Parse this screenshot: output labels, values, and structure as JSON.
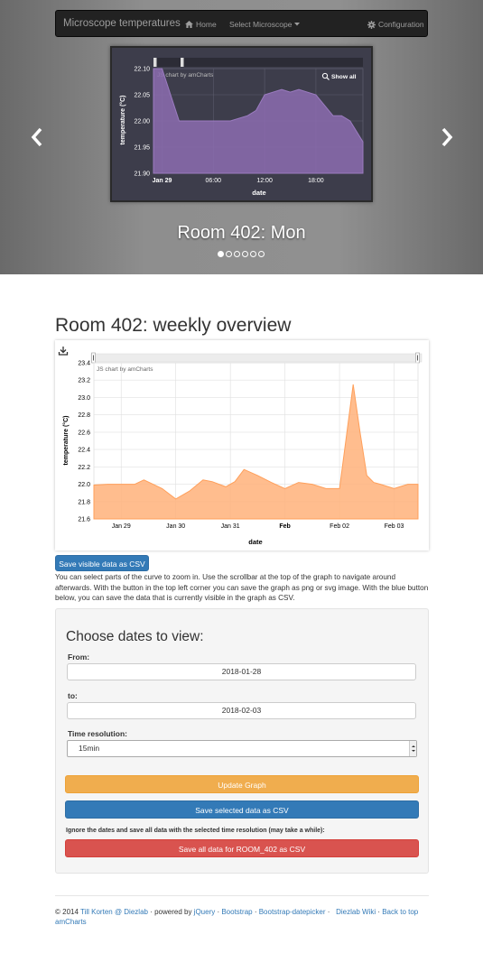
{
  "navbar": {
    "brand": "Microscope temperatures",
    "home": "Home",
    "select_microscope": "Select Microscope",
    "configuration": "Configuration"
  },
  "carousel": {
    "caption": "Room 402: Mon",
    "slide_count": 6,
    "active_slide": 0,
    "chart": {
      "credit": "JS chart by amCharts",
      "show_all": "Show all",
      "xlabel": "date",
      "ylabel": "temperature (°C)",
      "y_ticks": [
        "22.10",
        "22.05",
        "22.00",
        "21.95",
        "21.90"
      ],
      "x_ticks": [
        "Jan 29",
        "06:00",
        "12:00",
        "18:00"
      ],
      "bold_x_ticks": [
        "Jan 29"
      ]
    }
  },
  "main": {
    "title": "Room 402: weekly overview",
    "save_visible_label": "Save visible data as CSV",
    "help_text": "You can select parts of the curve to zoom in. Use the scrollbar at the top of the graph to navigate around afterwards. With the button in the top left corner you can save the graph as png or svg image. With the blue button below, you can save the data that is currently visible in the graph as CSV."
  },
  "weekly_chart": {
    "credit": "JS chart by amCharts",
    "xlabel": "date",
    "ylabel": "temperature (°C)",
    "y_ticks": [
      "23.4",
      "23.2",
      "23.0",
      "22.8",
      "22.6",
      "22.4",
      "22.2",
      "22.0",
      "21.8",
      "21.6"
    ],
    "x_ticks": [
      "Jan 29",
      "Jan 30",
      "Jan 31",
      "Feb",
      "Feb 02",
      "Feb 03"
    ],
    "bold_x_ticks": [
      "Feb"
    ]
  },
  "date_form": {
    "title": "Choose dates to view:",
    "from_label": "From:",
    "from_value": "2018-01-28",
    "to_label": "to:",
    "to_value": "2018-02-03",
    "resolution_label": "Time resolution:",
    "resolution_value": "15min",
    "update_label": "Update Graph",
    "save_selected_label": "Save selected data as CSV",
    "ignore_note": "Ignore the dates and save all data with the selected time resolution (may take a while):",
    "save_all_label": "Save all data for ROOM_402 as CSV"
  },
  "footer": {
    "copyright": "© 2014",
    "author": "Till Korten @ Diezlab",
    "powered_by": " · powered by",
    "jquery": "jQuery",
    "bootstrap": "Bootstrap",
    "datepicker": "Bootstrap-datepicker",
    "amcharts": "amCharts",
    "sep": " · ",
    "wiki": "Diezlab Wiki",
    "back_to_top": "Back to top"
  },
  "colors": {
    "carousel_area": "#8c6cb0",
    "weekly_area": "#ffb27a",
    "primary": "#337ab7",
    "warning": "#f0ad4e",
    "danger": "#d9534f"
  },
  "chart_data": [
    {
      "type": "area",
      "title": "",
      "xlabel": "date",
      "ylabel": "temperature (°C)",
      "ylim": [
        21.9,
        22.1
      ],
      "x": [
        "Jan 29 00:00",
        "Jan 29 02:00",
        "Jan 29 04:00",
        "Jan 29 06:00",
        "Jan 29 08:00",
        "Jan 29 10:00",
        "Jan 29 11:00",
        "Jan 29 12:00",
        "Jan 29 14:00",
        "Jan 29 15:00",
        "Jan 29 16:00",
        "Jan 29 18:00",
        "Jan 29 20:00",
        "Jan 29 21:00",
        "Jan 29 22:00",
        "Jan 29 23:30"
      ],
      "series": [
        {
          "values": [
            22.1,
            22.0,
            22.0,
            22.0,
            22.0,
            22.01,
            22.02,
            22.05,
            22.06,
            22.055,
            22.06,
            22.05,
            22.01,
            22.01,
            22.0,
            21.96
          ]
        }
      ]
    },
    {
      "type": "area",
      "title": "",
      "xlabel": "date",
      "ylabel": "temperature (°C)",
      "ylim": [
        21.6,
        23.4
      ],
      "x": [
        "Jan 28 12:00",
        "Jan 28 18:00",
        "Jan 29 00:00",
        "Jan 29 06:00",
        "Jan 29 10:00",
        "Jan 29 14:00",
        "Jan 29 18:00",
        "Jan 30 00:00",
        "Jan 30 06:00",
        "Jan 30 12:00",
        "Jan 30 16:00",
        "Jan 30 22:00",
        "Jan 31 02:00",
        "Jan 31 06:00",
        "Jan 31 12:00",
        "Jan 31 18:00",
        "Feb 01 00:00",
        "Feb 01 06:00",
        "Feb 01 12:00",
        "Feb 01 18:00",
        "Feb 02 00:00",
        "Feb 02 06:00",
        "Feb 02 09:00",
        "Feb 02 12:00",
        "Feb 02 15:00",
        "Feb 02 18:00",
        "Feb 03 00:00",
        "Feb 03 06:00",
        "Feb 03 12:00"
      ],
      "series": [
        {
          "values": [
            21.99,
            22.0,
            22.0,
            22.0,
            22.05,
            22.0,
            21.95,
            21.83,
            21.92,
            22.05,
            22.03,
            21.97,
            22.03,
            22.17,
            22.1,
            22.02,
            21.95,
            22.02,
            22.0,
            21.95,
            21.95,
            23.15,
            22.6,
            22.1,
            22.02,
            22.0,
            21.95,
            22.0,
            22.0
          ]
        }
      ]
    }
  ]
}
